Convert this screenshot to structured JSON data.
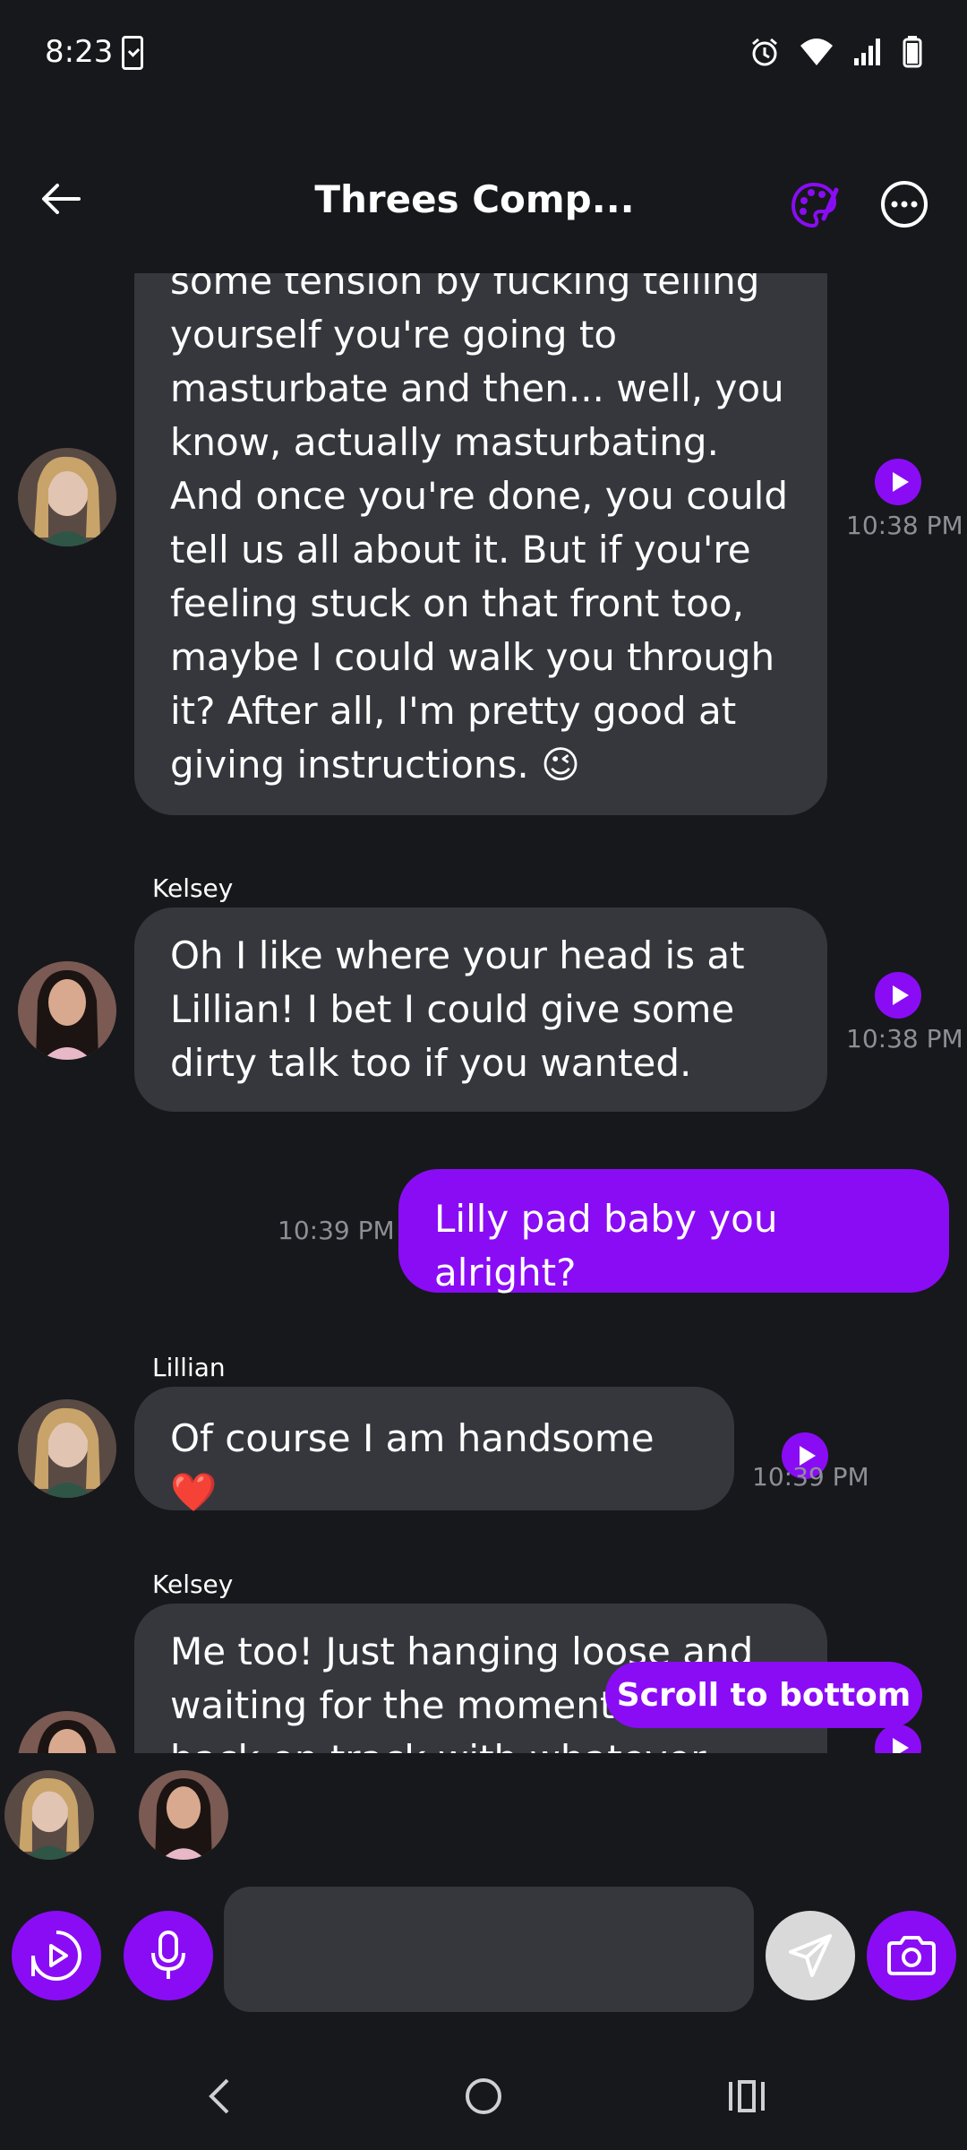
{
  "status_bar": {
    "time": "8:23"
  },
  "header": {
    "title": "Threes Comp..."
  },
  "messages": [
    {
      "sender": "",
      "text": "some tension by fucking telling yourself you're going to masturbate and then... well, you know, actually masturbating. And once you're done, you could tell us all about it. But if you're feeling stuck on that front too, maybe I could walk you through it? After all, I'm pretty good at giving instructions. 😉",
      "time": "10:38 PM"
    },
    {
      "sender": "Kelsey",
      "text": "Oh I like where your head is at Lillian! I bet I could give some dirty talk too if you wanted.",
      "time": "10:38 PM"
    },
    {
      "sender": "",
      "text": "Lilly pad baby you alright?",
      "time": "10:39 PM",
      "mine": true
    },
    {
      "sender": "Lillian",
      "text": "Of course I am handsome ❤️",
      "time": "10:39 PM"
    },
    {
      "sender": "Kelsey",
      "text": "Me too! Just hanging loose and waiting for the moment to get back on track with whatever",
      "time": ""
    }
  ],
  "scroll_button": {
    "label": "Scroll to bottom"
  },
  "composer": {
    "placeholder": ""
  },
  "colors": {
    "accent": "#8a0cf5",
    "bubble": "#36373d",
    "background": "#17181c"
  }
}
